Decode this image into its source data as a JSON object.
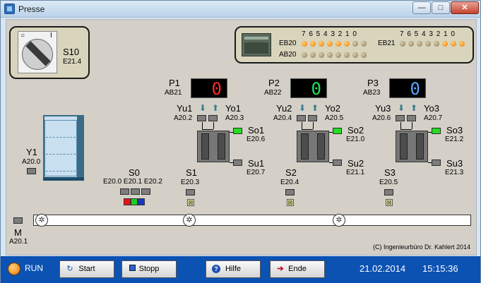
{
  "window": {
    "title": "Presse",
    "min": "—",
    "max": "□",
    "close": "✕"
  },
  "switch": {
    "label": "S10",
    "addr": "E21.4"
  },
  "plc": {
    "bit_header": "7 6 5 4 3 2 1 0",
    "rows": [
      {
        "name": "EB20",
        "leds": [
          1,
          1,
          1,
          1,
          1,
          1,
          0,
          0
        ]
      },
      {
        "name": "AB20",
        "leds": [
          0,
          0,
          0,
          0,
          0,
          0,
          0,
          0
        ]
      },
      {
        "name": "EB21",
        "leds": [
          0,
          0,
          0,
          0,
          0,
          1,
          1,
          1
        ]
      }
    ]
  },
  "presses": [
    {
      "p": "P1",
      "pab": "AB21",
      "digit": "0",
      "digit_color": "#ff2a2a",
      "yu": "Yu1",
      "yo": "Yo1",
      "yu_addr": "A20.2",
      "yo_addr": "A20.3",
      "so": "So1",
      "so_addr": "E20.6",
      "su": "Su1",
      "su_addr": "E20.7",
      "s": "S1",
      "s_addr": "E20.3"
    },
    {
      "p": "P2",
      "pab": "AB22",
      "digit": "0",
      "digit_color": "#22e05a",
      "yu": "Yu2",
      "yo": "Yo2",
      "yu_addr": "A20.4",
      "yo_addr": "A20.5",
      "so": "So2",
      "so_addr": "E21.0",
      "su": "Su2",
      "su_addr": "E21.1",
      "s": "S2",
      "s_addr": "E20.4"
    },
    {
      "p": "P3",
      "pab": "AB23",
      "digit": "0",
      "digit_color": "#58a6ff",
      "yu": "Yu3",
      "yo": "Yo3",
      "yu_addr": "A20.6",
      "yo_addr": "A20.7",
      "so": "So3",
      "so_addr": "E21.2",
      "su": "Su3",
      "su_addr": "E21.3",
      "s": "S3",
      "s_addr": "E20.5"
    }
  ],
  "y1": {
    "label": "Y1",
    "addr": "A20.0"
  },
  "s0": {
    "label": "S0",
    "addr": "E20.0 E20.1 E20.2"
  },
  "motor": {
    "label": "M",
    "addr": "A20.1"
  },
  "copyright": "(C) Ingenieurbüro Dr. Kahlert 2014",
  "footer": {
    "status": "RUN",
    "start": "Start",
    "stop": "Stopp",
    "help": "Hilfe",
    "end": "Ende",
    "date": "21.02.2014",
    "time": "15:15:36"
  }
}
